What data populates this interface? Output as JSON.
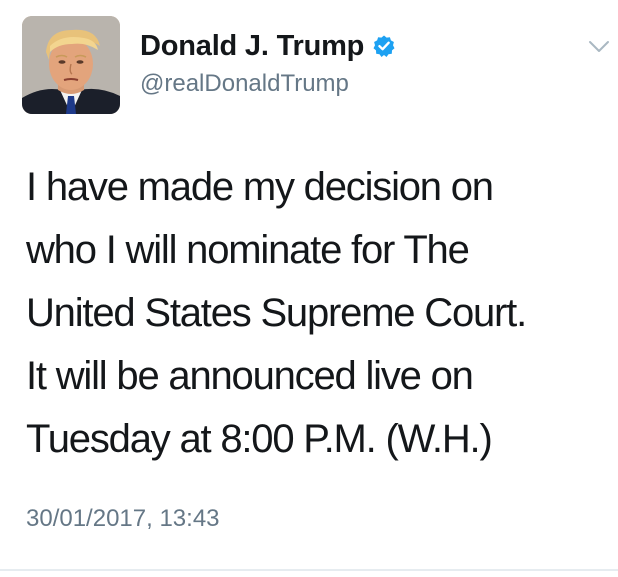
{
  "user": {
    "display_name": "Donald J. Trump",
    "handle": "@realDonaldTrump",
    "verified": true
  },
  "tweet": {
    "lines": [
      "I have made my decision on",
      "who I will nominate for The",
      "United States Supreme Court.",
      "It will be announced live on",
      "Tuesday at 8:00 P.M. (W.H.)"
    ],
    "timestamp": "30/01/2017, 13:43"
  },
  "colors": {
    "text": "#14171a",
    "secondary": "#657786",
    "verified_badge": "#1da1f2",
    "divider": "#e6ecf0"
  },
  "icons": {
    "verified": "verified-badge-icon",
    "menu": "chevron-down-icon"
  }
}
